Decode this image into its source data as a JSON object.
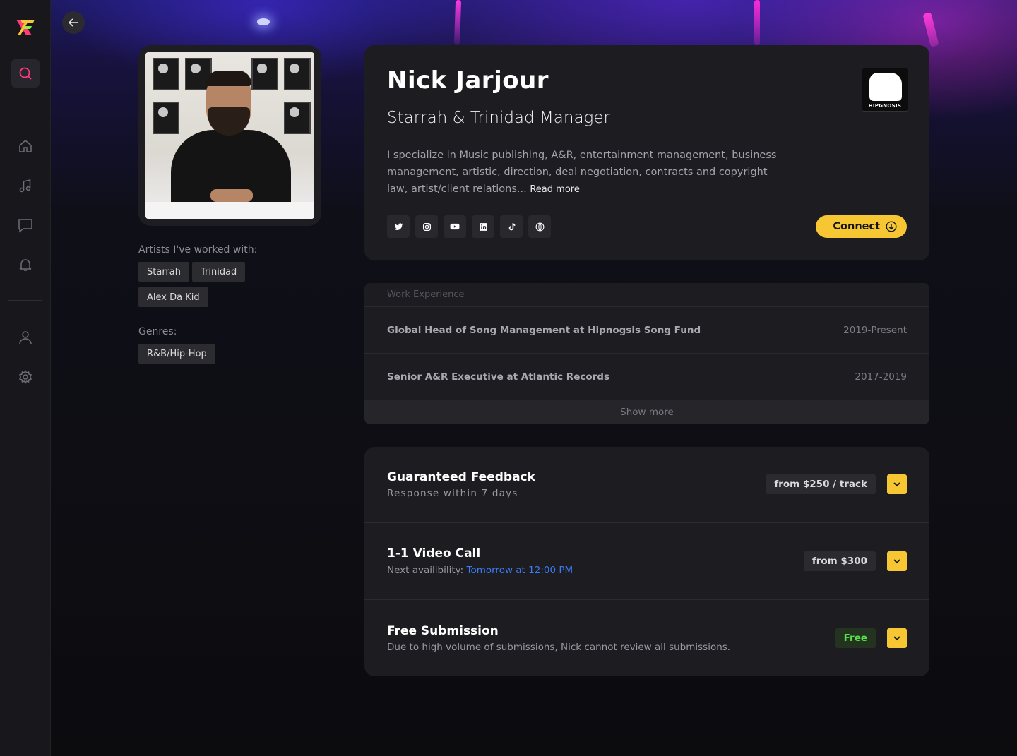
{
  "sidebar": {
    "items": [
      {
        "name": "search",
        "icon": "search-icon",
        "active": true
      },
      {
        "name": "home",
        "icon": "home-icon"
      },
      {
        "name": "music",
        "icon": "music-note-icon"
      },
      {
        "name": "messages",
        "icon": "chat-icon"
      },
      {
        "name": "notifications",
        "icon": "bell-icon"
      },
      {
        "name": "profile",
        "icon": "user-icon"
      },
      {
        "name": "settings",
        "icon": "gear-icon"
      }
    ]
  },
  "profile": {
    "name": "Nick Jarjour",
    "role": "Starrah & Trinidad Manager",
    "bio": "I specialize in Music publishing, A&R, entertainment management, business management, artistic, direction, deal negotiation, contracts and copyright law, artist/client relations...",
    "read_more": "Read more",
    "company_logo_text": "HIPGNOSIS",
    "connect_label": "Connect",
    "socials": [
      "twitter-icon",
      "instagram-icon",
      "youtube-icon",
      "linkedin-icon",
      "tiktok-icon",
      "globe-icon"
    ]
  },
  "artists": {
    "label": "Artists I've worked with:",
    "items": [
      "Starrah",
      "Trinidad",
      "Alex Da Kid"
    ]
  },
  "genres": {
    "label": "Genres:",
    "items": [
      "R&B/Hip-Hop"
    ]
  },
  "work": {
    "header": "Work Experience",
    "items": [
      {
        "title": "Global Head of Song Management at Hipnogsis Song Fund",
        "years": "2019-Present"
      },
      {
        "title": "Senior A&R Executive at Atlantic Records",
        "years": "2017-2019"
      }
    ],
    "show_more": "Show more"
  },
  "services": [
    {
      "title": "Guaranteed Feedback",
      "subtitle": "Response within 7 days",
      "price": "from $250 / track"
    },
    {
      "title": "1-1 Video Call",
      "subtitle_prefix": "Next availibility: ",
      "subtitle_link": "Tomorrow at 12:00 PM",
      "price": "from $300"
    },
    {
      "title": "Free Submission",
      "subtitle": "Due to high volume of submissions, Nick cannot review all submissions.",
      "price": "Free"
    }
  ],
  "colors": {
    "accent": "#f6c633",
    "link": "#3d7bf5",
    "free_green": "#55e04b",
    "search_active": "#ff3b7a"
  }
}
